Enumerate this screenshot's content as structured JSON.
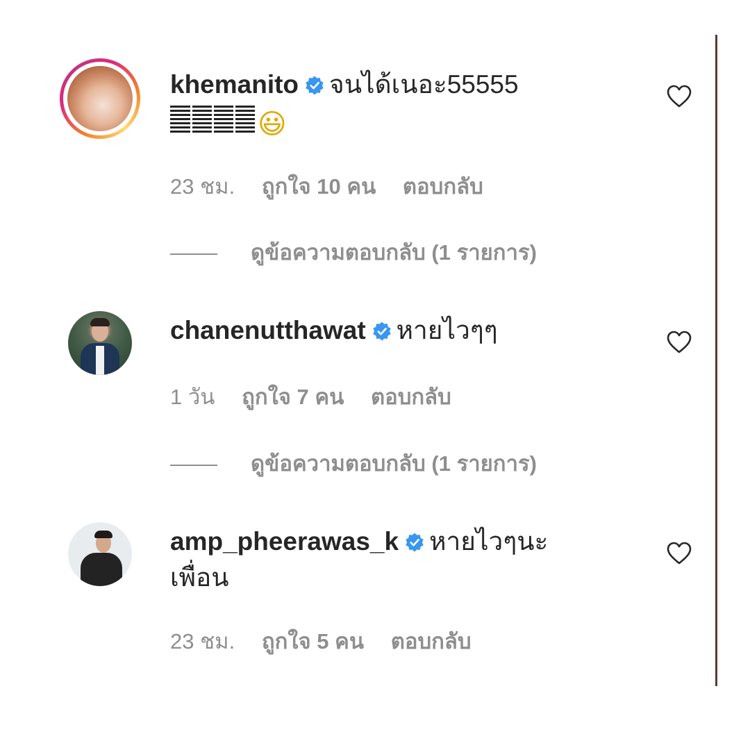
{
  "comments": [
    {
      "username": "khemanito",
      "text": "จนได้เนอะ55555",
      "emoji": "😃",
      "time": "23 ชม.",
      "likes": "ถูกใจ 10 คน",
      "reply": "ตอบกลับ",
      "view_replies": "ดูข้อความตอบกลับ (1 รายการ)"
    },
    {
      "username": "chanenutthawat",
      "text": "หายไวๆๆ",
      "time": "1 วัน",
      "likes": "ถูกใจ 7 คน",
      "reply": "ตอบกลับ",
      "view_replies": "ดูข้อความตอบกลับ (1 รายการ)"
    },
    {
      "username": "amp_pheerawas_k",
      "text": "หายไวๆนะ",
      "text_line2": "เพื่อน",
      "time": "23 ชม.",
      "likes": "ถูกใจ 5 คน",
      "reply": "ตอบกลับ"
    }
  ],
  "colors": {
    "verified": "#3897f0",
    "muted": "#8e8e8e",
    "text": "#262626"
  },
  "icons": [
    "verified-badge-icon",
    "heart-outline-icon",
    "story-ring-avatar"
  ]
}
